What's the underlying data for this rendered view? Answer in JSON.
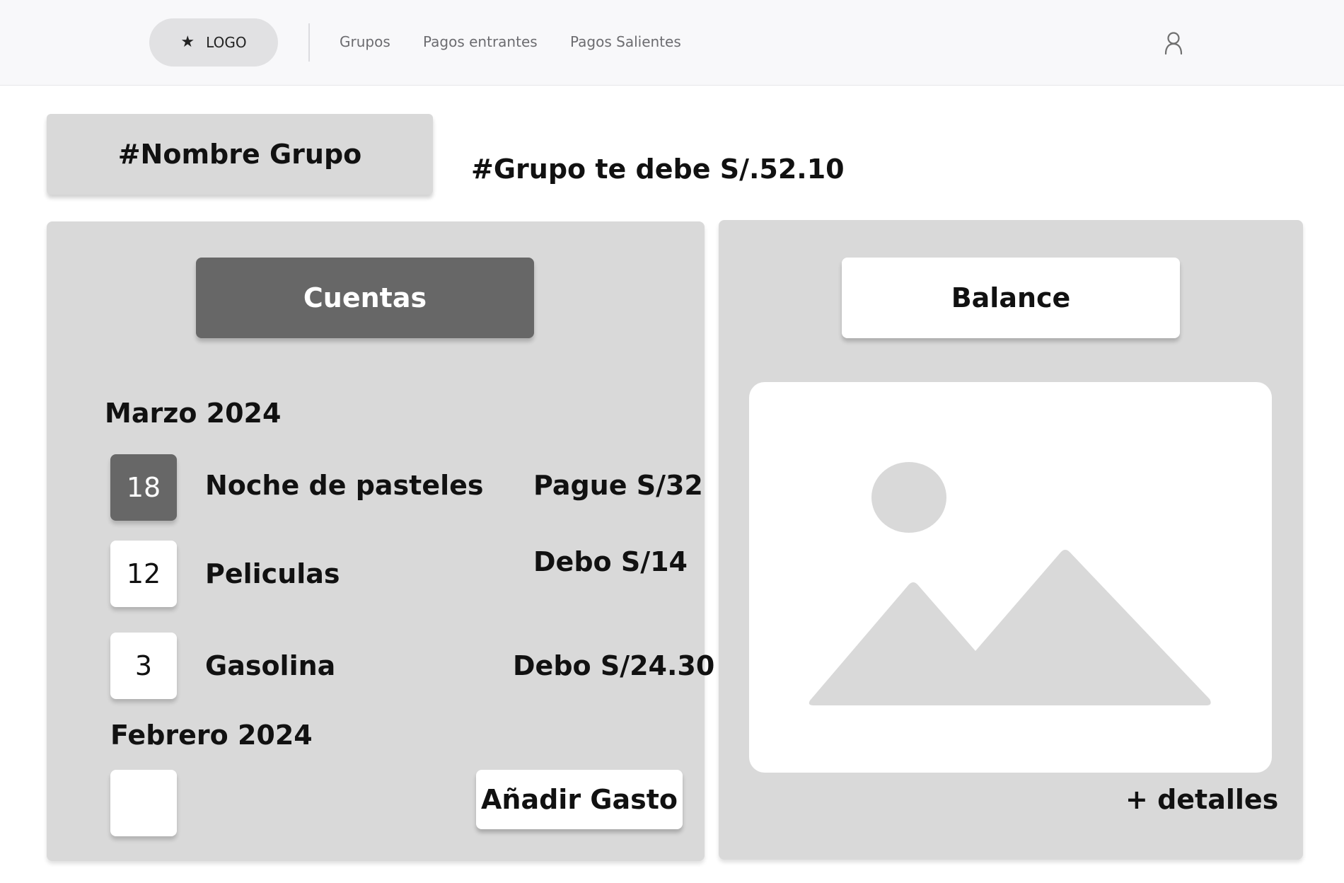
{
  "nav": {
    "logo_label": "LOGO",
    "links": [
      "Grupos",
      "Pagos entrantes",
      "Pagos Salientes"
    ]
  },
  "header": {
    "group_name": "#Nombre Grupo",
    "group_owes": "#Grupo te debe S/.52.10"
  },
  "cuentas": {
    "tab_label": "Cuentas",
    "months": [
      {
        "label": "Marzo 2024",
        "entries": [
          {
            "day": "18",
            "name": "Noche de pasteles",
            "amount": "Pague S/32",
            "selected": true
          },
          {
            "day": "12",
            "name": "Peliculas",
            "amount": "Debo S/14",
            "selected": false
          },
          {
            "day": "3",
            "name": "Gasolina",
            "amount": "Debo S/24.30",
            "selected": false
          }
        ]
      },
      {
        "label": "Febrero 2024",
        "entries": [
          {
            "day": "",
            "name": "",
            "amount": "",
            "selected": false
          }
        ]
      }
    ],
    "add_button": "Añadir Gasto"
  },
  "balance": {
    "tab_label": "Balance",
    "details_link": "+ detalles"
  },
  "colors": {
    "panel": "#d9d9d9",
    "active_tab": "#676767",
    "topbar": "#f8f8fa",
    "logo_pill": "#e1e1e3"
  }
}
